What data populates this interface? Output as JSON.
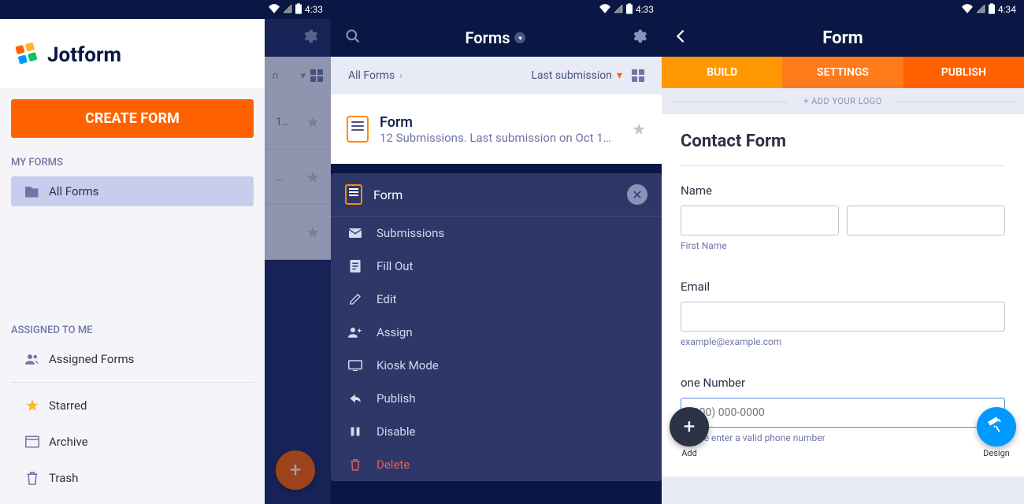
{
  "status": {
    "time1": "4:33",
    "time2": "4:33",
    "time3": "4:34"
  },
  "screen1": {
    "logo_text": "Jotform",
    "create_btn": "CREATE FORM",
    "sections": {
      "my_forms": "MY FORMS",
      "assigned": "ASSIGNED TO ME"
    },
    "nav": {
      "all_forms": "All Forms",
      "assigned_forms": "Assigned Forms",
      "starred": "Starred",
      "archive": "Archive",
      "trash": "Trash"
    },
    "peek_filter": "n",
    "peek_row_text": "1…"
  },
  "screen2": {
    "header_title": "Forms",
    "filter_left": "All Forms",
    "filter_right": "Last submission",
    "form_card": {
      "title": "Form",
      "subtitle": "12 Submissions. Last submission on Oct 1…"
    },
    "menu": {
      "title": "Form",
      "items": {
        "submissions": "Submissions",
        "fill_out": "Fill Out",
        "edit": "Edit",
        "assign": "Assign",
        "kiosk": "Kiosk Mode",
        "publish": "Publish",
        "disable": "Disable",
        "delete": "Delete"
      }
    }
  },
  "screen3": {
    "header_title": "Form",
    "tabs": {
      "build": "BUILD",
      "settings": "SETTINGS",
      "publish": "PUBLISH"
    },
    "add_logo": "+ ADD YOUR LOGO",
    "canvas_title": "Contact Form",
    "fields": {
      "name_label": "Name",
      "first_name_sub": "First Name",
      "email_label": "Email",
      "email_sub": "example@example.com",
      "phone_label": "one Number",
      "phone_placeholder": "(000) 000-0000",
      "phone_sub": "Please enter a valid phone number"
    },
    "fab_add_label": "Add",
    "fab_design_label": "Design"
  }
}
